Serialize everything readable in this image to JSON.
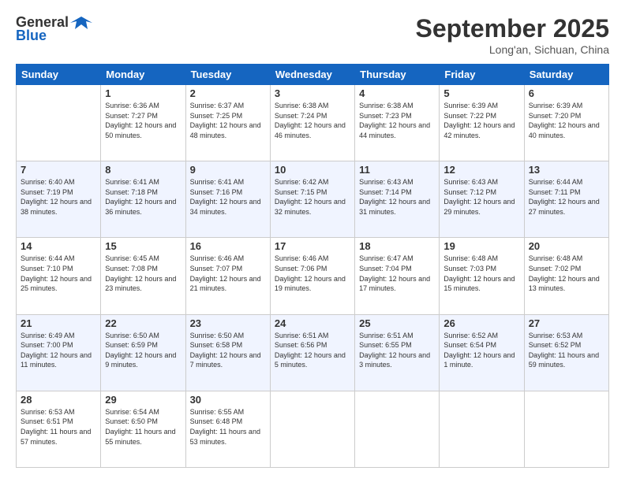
{
  "header": {
    "logo_general": "General",
    "logo_blue": "Blue",
    "month": "September 2025",
    "location": "Long'an, Sichuan, China"
  },
  "days": [
    "Sunday",
    "Monday",
    "Tuesday",
    "Wednesday",
    "Thursday",
    "Friday",
    "Saturday"
  ],
  "weeks": [
    [
      {
        "num": "",
        "sunrise": "",
        "sunset": "",
        "daylight": ""
      },
      {
        "num": "1",
        "sunrise": "Sunrise: 6:36 AM",
        "sunset": "Sunset: 7:27 PM",
        "daylight": "Daylight: 12 hours and 50 minutes."
      },
      {
        "num": "2",
        "sunrise": "Sunrise: 6:37 AM",
        "sunset": "Sunset: 7:25 PM",
        "daylight": "Daylight: 12 hours and 48 minutes."
      },
      {
        "num": "3",
        "sunrise": "Sunrise: 6:38 AM",
        "sunset": "Sunset: 7:24 PM",
        "daylight": "Daylight: 12 hours and 46 minutes."
      },
      {
        "num": "4",
        "sunrise": "Sunrise: 6:38 AM",
        "sunset": "Sunset: 7:23 PM",
        "daylight": "Daylight: 12 hours and 44 minutes."
      },
      {
        "num": "5",
        "sunrise": "Sunrise: 6:39 AM",
        "sunset": "Sunset: 7:22 PM",
        "daylight": "Daylight: 12 hours and 42 minutes."
      },
      {
        "num": "6",
        "sunrise": "Sunrise: 6:39 AM",
        "sunset": "Sunset: 7:20 PM",
        "daylight": "Daylight: 12 hours and 40 minutes."
      }
    ],
    [
      {
        "num": "7",
        "sunrise": "Sunrise: 6:40 AM",
        "sunset": "Sunset: 7:19 PM",
        "daylight": "Daylight: 12 hours and 38 minutes."
      },
      {
        "num": "8",
        "sunrise": "Sunrise: 6:41 AM",
        "sunset": "Sunset: 7:18 PM",
        "daylight": "Daylight: 12 hours and 36 minutes."
      },
      {
        "num": "9",
        "sunrise": "Sunrise: 6:41 AM",
        "sunset": "Sunset: 7:16 PM",
        "daylight": "Daylight: 12 hours and 34 minutes."
      },
      {
        "num": "10",
        "sunrise": "Sunrise: 6:42 AM",
        "sunset": "Sunset: 7:15 PM",
        "daylight": "Daylight: 12 hours and 32 minutes."
      },
      {
        "num": "11",
        "sunrise": "Sunrise: 6:43 AM",
        "sunset": "Sunset: 7:14 PM",
        "daylight": "Daylight: 12 hours and 31 minutes."
      },
      {
        "num": "12",
        "sunrise": "Sunrise: 6:43 AM",
        "sunset": "Sunset: 7:12 PM",
        "daylight": "Daylight: 12 hours and 29 minutes."
      },
      {
        "num": "13",
        "sunrise": "Sunrise: 6:44 AM",
        "sunset": "Sunset: 7:11 PM",
        "daylight": "Daylight: 12 hours and 27 minutes."
      }
    ],
    [
      {
        "num": "14",
        "sunrise": "Sunrise: 6:44 AM",
        "sunset": "Sunset: 7:10 PM",
        "daylight": "Daylight: 12 hours and 25 minutes."
      },
      {
        "num": "15",
        "sunrise": "Sunrise: 6:45 AM",
        "sunset": "Sunset: 7:08 PM",
        "daylight": "Daylight: 12 hours and 23 minutes."
      },
      {
        "num": "16",
        "sunrise": "Sunrise: 6:46 AM",
        "sunset": "Sunset: 7:07 PM",
        "daylight": "Daylight: 12 hours and 21 minutes."
      },
      {
        "num": "17",
        "sunrise": "Sunrise: 6:46 AM",
        "sunset": "Sunset: 7:06 PM",
        "daylight": "Daylight: 12 hours and 19 minutes."
      },
      {
        "num": "18",
        "sunrise": "Sunrise: 6:47 AM",
        "sunset": "Sunset: 7:04 PM",
        "daylight": "Daylight: 12 hours and 17 minutes."
      },
      {
        "num": "19",
        "sunrise": "Sunrise: 6:48 AM",
        "sunset": "Sunset: 7:03 PM",
        "daylight": "Daylight: 12 hours and 15 minutes."
      },
      {
        "num": "20",
        "sunrise": "Sunrise: 6:48 AM",
        "sunset": "Sunset: 7:02 PM",
        "daylight": "Daylight: 12 hours and 13 minutes."
      }
    ],
    [
      {
        "num": "21",
        "sunrise": "Sunrise: 6:49 AM",
        "sunset": "Sunset: 7:00 PM",
        "daylight": "Daylight: 12 hours and 11 minutes."
      },
      {
        "num": "22",
        "sunrise": "Sunrise: 6:50 AM",
        "sunset": "Sunset: 6:59 PM",
        "daylight": "Daylight: 12 hours and 9 minutes."
      },
      {
        "num": "23",
        "sunrise": "Sunrise: 6:50 AM",
        "sunset": "Sunset: 6:58 PM",
        "daylight": "Daylight: 12 hours and 7 minutes."
      },
      {
        "num": "24",
        "sunrise": "Sunrise: 6:51 AM",
        "sunset": "Sunset: 6:56 PM",
        "daylight": "Daylight: 12 hours and 5 minutes."
      },
      {
        "num": "25",
        "sunrise": "Sunrise: 6:51 AM",
        "sunset": "Sunset: 6:55 PM",
        "daylight": "Daylight: 12 hours and 3 minutes."
      },
      {
        "num": "26",
        "sunrise": "Sunrise: 6:52 AM",
        "sunset": "Sunset: 6:54 PM",
        "daylight": "Daylight: 12 hours and 1 minute."
      },
      {
        "num": "27",
        "sunrise": "Sunrise: 6:53 AM",
        "sunset": "Sunset: 6:52 PM",
        "daylight": "Daylight: 11 hours and 59 minutes."
      }
    ],
    [
      {
        "num": "28",
        "sunrise": "Sunrise: 6:53 AM",
        "sunset": "Sunset: 6:51 PM",
        "daylight": "Daylight: 11 hours and 57 minutes."
      },
      {
        "num": "29",
        "sunrise": "Sunrise: 6:54 AM",
        "sunset": "Sunset: 6:50 PM",
        "daylight": "Daylight: 11 hours and 55 minutes."
      },
      {
        "num": "30",
        "sunrise": "Sunrise: 6:55 AM",
        "sunset": "Sunset: 6:48 PM",
        "daylight": "Daylight: 11 hours and 53 minutes."
      },
      {
        "num": "",
        "sunrise": "",
        "sunset": "",
        "daylight": ""
      },
      {
        "num": "",
        "sunrise": "",
        "sunset": "",
        "daylight": ""
      },
      {
        "num": "",
        "sunrise": "",
        "sunset": "",
        "daylight": ""
      },
      {
        "num": "",
        "sunrise": "",
        "sunset": "",
        "daylight": ""
      }
    ]
  ]
}
